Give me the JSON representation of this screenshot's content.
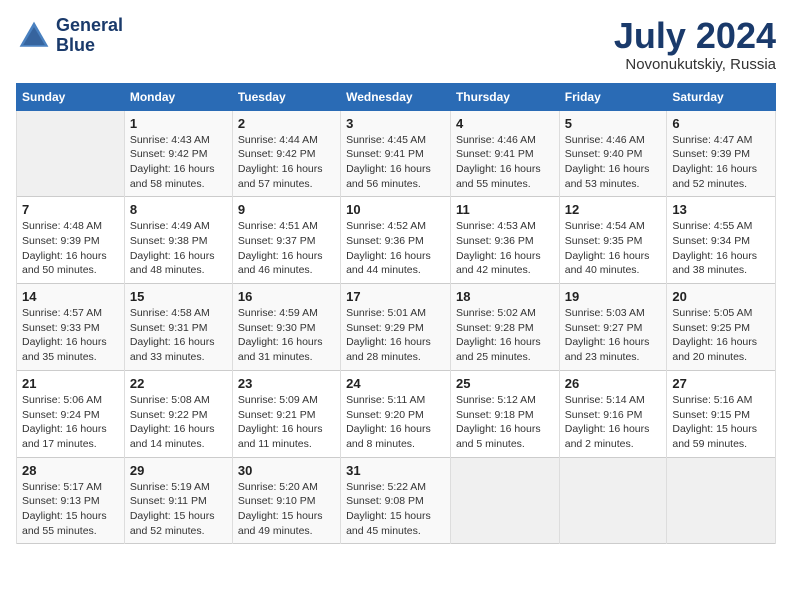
{
  "header": {
    "logo_line1": "General",
    "logo_line2": "Blue",
    "month_year": "July 2024",
    "location": "Novonukutskiy, Russia"
  },
  "days_of_week": [
    "Sunday",
    "Monday",
    "Tuesday",
    "Wednesday",
    "Thursday",
    "Friday",
    "Saturday"
  ],
  "weeks": [
    [
      {
        "day": "",
        "text": ""
      },
      {
        "day": "1",
        "text": "Sunrise: 4:43 AM\nSunset: 9:42 PM\nDaylight: 16 hours\nand 58 minutes."
      },
      {
        "day": "2",
        "text": "Sunrise: 4:44 AM\nSunset: 9:42 PM\nDaylight: 16 hours\nand 57 minutes."
      },
      {
        "day": "3",
        "text": "Sunrise: 4:45 AM\nSunset: 9:41 PM\nDaylight: 16 hours\nand 56 minutes."
      },
      {
        "day": "4",
        "text": "Sunrise: 4:46 AM\nSunset: 9:41 PM\nDaylight: 16 hours\nand 55 minutes."
      },
      {
        "day": "5",
        "text": "Sunrise: 4:46 AM\nSunset: 9:40 PM\nDaylight: 16 hours\nand 53 minutes."
      },
      {
        "day": "6",
        "text": "Sunrise: 4:47 AM\nSunset: 9:39 PM\nDaylight: 16 hours\nand 52 minutes."
      }
    ],
    [
      {
        "day": "7",
        "text": "Sunrise: 4:48 AM\nSunset: 9:39 PM\nDaylight: 16 hours\nand 50 minutes."
      },
      {
        "day": "8",
        "text": "Sunrise: 4:49 AM\nSunset: 9:38 PM\nDaylight: 16 hours\nand 48 minutes."
      },
      {
        "day": "9",
        "text": "Sunrise: 4:51 AM\nSunset: 9:37 PM\nDaylight: 16 hours\nand 46 minutes."
      },
      {
        "day": "10",
        "text": "Sunrise: 4:52 AM\nSunset: 9:36 PM\nDaylight: 16 hours\nand 44 minutes."
      },
      {
        "day": "11",
        "text": "Sunrise: 4:53 AM\nSunset: 9:36 PM\nDaylight: 16 hours\nand 42 minutes."
      },
      {
        "day": "12",
        "text": "Sunrise: 4:54 AM\nSunset: 9:35 PM\nDaylight: 16 hours\nand 40 minutes."
      },
      {
        "day": "13",
        "text": "Sunrise: 4:55 AM\nSunset: 9:34 PM\nDaylight: 16 hours\nand 38 minutes."
      }
    ],
    [
      {
        "day": "14",
        "text": "Sunrise: 4:57 AM\nSunset: 9:33 PM\nDaylight: 16 hours\nand 35 minutes."
      },
      {
        "day": "15",
        "text": "Sunrise: 4:58 AM\nSunset: 9:31 PM\nDaylight: 16 hours\nand 33 minutes."
      },
      {
        "day": "16",
        "text": "Sunrise: 4:59 AM\nSunset: 9:30 PM\nDaylight: 16 hours\nand 31 minutes."
      },
      {
        "day": "17",
        "text": "Sunrise: 5:01 AM\nSunset: 9:29 PM\nDaylight: 16 hours\nand 28 minutes."
      },
      {
        "day": "18",
        "text": "Sunrise: 5:02 AM\nSunset: 9:28 PM\nDaylight: 16 hours\nand 25 minutes."
      },
      {
        "day": "19",
        "text": "Sunrise: 5:03 AM\nSunset: 9:27 PM\nDaylight: 16 hours\nand 23 minutes."
      },
      {
        "day": "20",
        "text": "Sunrise: 5:05 AM\nSunset: 9:25 PM\nDaylight: 16 hours\nand 20 minutes."
      }
    ],
    [
      {
        "day": "21",
        "text": "Sunrise: 5:06 AM\nSunset: 9:24 PM\nDaylight: 16 hours\nand 17 minutes."
      },
      {
        "day": "22",
        "text": "Sunrise: 5:08 AM\nSunset: 9:22 PM\nDaylight: 16 hours\nand 14 minutes."
      },
      {
        "day": "23",
        "text": "Sunrise: 5:09 AM\nSunset: 9:21 PM\nDaylight: 16 hours\nand 11 minutes."
      },
      {
        "day": "24",
        "text": "Sunrise: 5:11 AM\nSunset: 9:20 PM\nDaylight: 16 hours\nand 8 minutes."
      },
      {
        "day": "25",
        "text": "Sunrise: 5:12 AM\nSunset: 9:18 PM\nDaylight: 16 hours\nand 5 minutes."
      },
      {
        "day": "26",
        "text": "Sunrise: 5:14 AM\nSunset: 9:16 PM\nDaylight: 16 hours\nand 2 minutes."
      },
      {
        "day": "27",
        "text": "Sunrise: 5:16 AM\nSunset: 9:15 PM\nDaylight: 15 hours\nand 59 minutes."
      }
    ],
    [
      {
        "day": "28",
        "text": "Sunrise: 5:17 AM\nSunset: 9:13 PM\nDaylight: 15 hours\nand 55 minutes."
      },
      {
        "day": "29",
        "text": "Sunrise: 5:19 AM\nSunset: 9:11 PM\nDaylight: 15 hours\nand 52 minutes."
      },
      {
        "day": "30",
        "text": "Sunrise: 5:20 AM\nSunset: 9:10 PM\nDaylight: 15 hours\nand 49 minutes."
      },
      {
        "day": "31",
        "text": "Sunrise: 5:22 AM\nSunset: 9:08 PM\nDaylight: 15 hours\nand 45 minutes."
      },
      {
        "day": "",
        "text": ""
      },
      {
        "day": "",
        "text": ""
      },
      {
        "day": "",
        "text": ""
      }
    ]
  ]
}
